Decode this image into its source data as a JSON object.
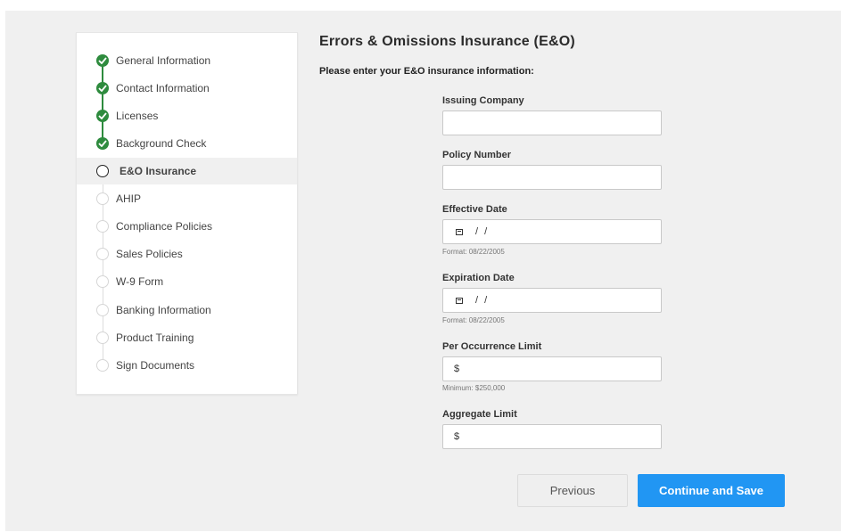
{
  "steps": [
    {
      "label": "General Information",
      "status": "done"
    },
    {
      "label": "Contact Information",
      "status": "done"
    },
    {
      "label": "Licenses",
      "status": "done"
    },
    {
      "label": "Background Check",
      "status": "done"
    },
    {
      "label": "E&O Insurance",
      "status": "current"
    },
    {
      "label": "AHIP",
      "status": "todo"
    },
    {
      "label": "Compliance Policies",
      "status": "todo"
    },
    {
      "label": "Sales Policies",
      "status": "todo"
    },
    {
      "label": "W-9 Form",
      "status": "todo"
    },
    {
      "label": "Banking Information",
      "status": "todo"
    },
    {
      "label": "Product Training",
      "status": "todo"
    },
    {
      "label": "Sign Documents",
      "status": "todo"
    }
  ],
  "form": {
    "title": "Errors & Omissions Insurance (E&O)",
    "subtitle": "Please enter your E&O insurance information:",
    "issuing_company": {
      "label": "Issuing Company",
      "value": ""
    },
    "policy_number": {
      "label": "Policy Number",
      "value": ""
    },
    "effective_date": {
      "label": "Effective Date",
      "placeholder": "/ /",
      "hint": "Format: 08/22/2005"
    },
    "expiration_date": {
      "label": "Expiration Date",
      "placeholder": "/ /",
      "hint": "Format: 08/22/2005"
    },
    "per_occurrence_limit": {
      "label": "Per Occurrence Limit",
      "prefix": "$",
      "hint": "Minimum: $250,000"
    },
    "aggregate_limit": {
      "label": "Aggregate Limit",
      "prefix": "$"
    }
  },
  "buttons": {
    "previous": "Previous",
    "continue": "Continue and Save"
  },
  "colors": {
    "accent": "#2196f3",
    "done": "#2e8b3e",
    "background": "#f0f0f0"
  },
  "icons": {
    "done": "check-circle-icon",
    "current": "circle-outline-icon",
    "todo": "circle-outline-icon",
    "date": "calendar-icon"
  }
}
